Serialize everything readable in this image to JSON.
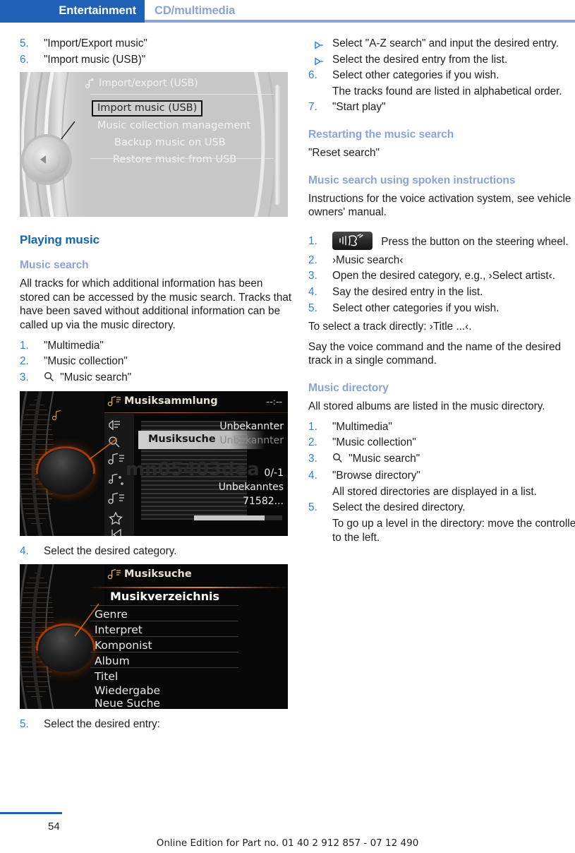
{
  "header": {
    "active_tab": "Entertainment",
    "inactive_tab": "CD/multimedia",
    "accent_blue": "#1e62b8",
    "rule_blue": "#8ba4d6"
  },
  "left_column": {
    "steps_top": [
      {
        "num": "5.",
        "text": "\"Import/Export music\""
      },
      {
        "num": "6.",
        "text": "\"Import music (USB)\""
      }
    ],
    "figure_import": {
      "title": "Import/export (USB)",
      "title_icon": "music-import-icon",
      "items": [
        "Import music (USB)",
        "Music collection management",
        "Backup music on USB",
        "Restore music from USB"
      ],
      "selected_index": 0
    },
    "section_title": "Playing music",
    "sub_title": "Music search",
    "intro": "All tracks for which additional information has been stored can be accessed by the music search. Tracks that have been saved without additional information can be called up via the music directory.",
    "steps_search": [
      {
        "num": "1.",
        "text": "\"Multimedia\""
      },
      {
        "num": "2.",
        "text": "\"Music collection\""
      },
      {
        "num": "3.",
        "text": "\"Music search\"",
        "icon": "magnifier-icon"
      }
    ],
    "figure_collection": {
      "title": "Musiksammlung",
      "clock": "--:--",
      "overlay_label": "Musiksuche",
      "art_text": "mn05403dea",
      "right_lines": [
        "Unbekannter",
        "Unbekannter",
        "0/-1",
        "Unbekanntes",
        "71582..."
      ],
      "icons": [
        "speaker-icon",
        "magnifier-icon",
        "note-list-icon",
        "note-shuffle-icon",
        "note-list-icon",
        "star-icon",
        "prev-track-icon",
        "next-track-icon"
      ]
    },
    "step_4": {
      "num": "4.",
      "text": "Select the desired category."
    },
    "figure_directory": {
      "title": "Musiksuche",
      "heading": "Musikverzeichnis",
      "items": [
        "Genre",
        "Interpret",
        "Komponist",
        "Album",
        "Titel",
        "Wiedergabe",
        "Neue Suche"
      ]
    },
    "step_5": {
      "num": "5.",
      "text": "Select the desired entry:"
    }
  },
  "right_column": {
    "bullets": [
      {
        "marker": "triangle-bullet-icon",
        "text": "Select \"A-Z search\" and input the desired entry."
      },
      {
        "marker": "triangle-bullet-icon",
        "text": "Select the desired entry from the list."
      }
    ],
    "step_6": {
      "num": "6.",
      "text": "Select other categories if you wish."
    },
    "note_6": "The tracks found are listed in alphabetical order.",
    "step_7": {
      "num": "7.",
      "text": "\"Start play\""
    },
    "sub_restart": "Restarting the music search",
    "restart_text": "\"Reset search\"",
    "sub_spoken": "Music search using spoken instructions",
    "spoken_intro": "Instructions for the voice activation system, see vehicle owners' manual.",
    "spoken_steps": [
      {
        "num": "1.",
        "text": "Press the button on the steering wheel.",
        "icon": "voice-button-icon"
      },
      {
        "num": "2.",
        "text": "›Music search‹"
      },
      {
        "num": "3.",
        "text": "Open the desired category, e.g., ›Select artist‹."
      },
      {
        "num": "4.",
        "text": "Say the desired entry in the list."
      },
      {
        "num": "5.",
        "text": "Select other categories if you wish."
      }
    ],
    "direct_note": "To select a track directly: ›Title ...‹.",
    "voice_note": "Say the voice command and the name of the desired track in a single command.",
    "sub_directory": "Music directory",
    "directory_intro": "All stored albums are listed in the music directory.",
    "directory_steps": [
      {
        "num": "1.",
        "text": "\"Multimedia\""
      },
      {
        "num": "2.",
        "text": "\"Music collection\""
      },
      {
        "num": "3.",
        "text": "\"Music search\"",
        "icon": "magnifier-icon"
      },
      {
        "num": "4.",
        "text": "\"Browse directory\""
      }
    ],
    "directory_note_4": "All stored directories are displayed in a list.",
    "step_5_dir": {
      "num": "5.",
      "text": "Select the desired directory."
    },
    "directory_note_5": "To go up a level in the directory: move the controller to the left."
  },
  "footer": {
    "page_number": "54",
    "note": "Online Edition for Part no. 01 40 2 912 857 - 07 12 490"
  }
}
